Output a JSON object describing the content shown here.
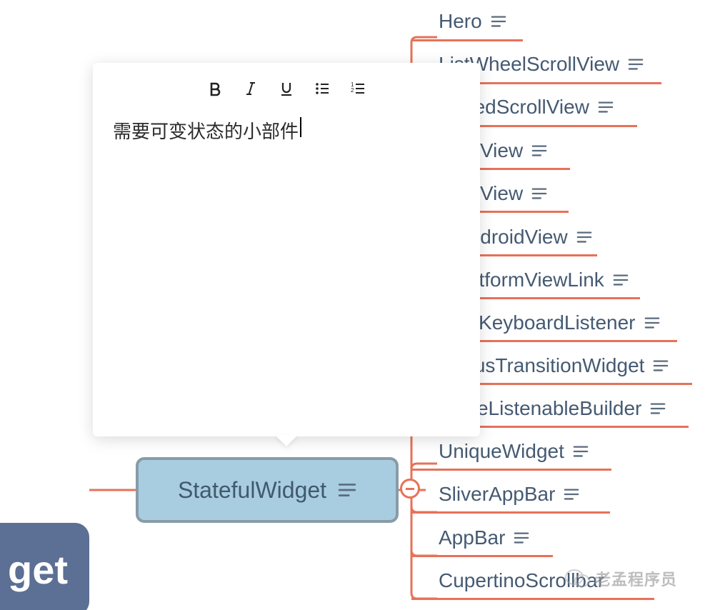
{
  "editor": {
    "content": "需要可变状态的小部件",
    "toolbar": {
      "bold": "B",
      "italic": "I",
      "underline": "U",
      "bullet_list": "bullet-list",
      "ordered_list": "ordered-list"
    }
  },
  "central_node": {
    "label": "StatefulWidget"
  },
  "root_node": {
    "label_fragment": "get"
  },
  "child_nodes": [
    {
      "label": "Hero"
    },
    {
      "label": "ListWheelScrollView"
    },
    {
      "label": "NestedScrollView",
      "obscured_prefix": true
    },
    {
      "label": "View",
      "obscured_prefix": true
    },
    {
      "label": "View",
      "obscured_prefix": true
    },
    {
      "label": "AndroidView",
      "obscured_prefix": true
    },
    {
      "label": "PlatformViewLink",
      "obscured_prefix": true
    },
    {
      "label": "RawKeyboardListener",
      "obscured_prefix": true
    },
    {
      "label": "StatusTransitionWidget",
      "obscured_prefix": true
    },
    {
      "label": "ValueListenableBuilder",
      "obscured_prefix": true
    },
    {
      "label": "UniqueWidget"
    },
    {
      "label": "SliverAppBar"
    },
    {
      "label": "AppBar"
    },
    {
      "label": "CupertinoScrollbar",
      "truncated": true
    }
  ],
  "collapse_btn": {
    "symbol": "−"
  },
  "watermark": {
    "text": "老孟程序员"
  },
  "colors": {
    "connector": "#e67259",
    "node_text": "#455a72",
    "central_bg": "#a9cde0",
    "central_border": "#889ca8",
    "root_bg": "#5c6f94"
  }
}
